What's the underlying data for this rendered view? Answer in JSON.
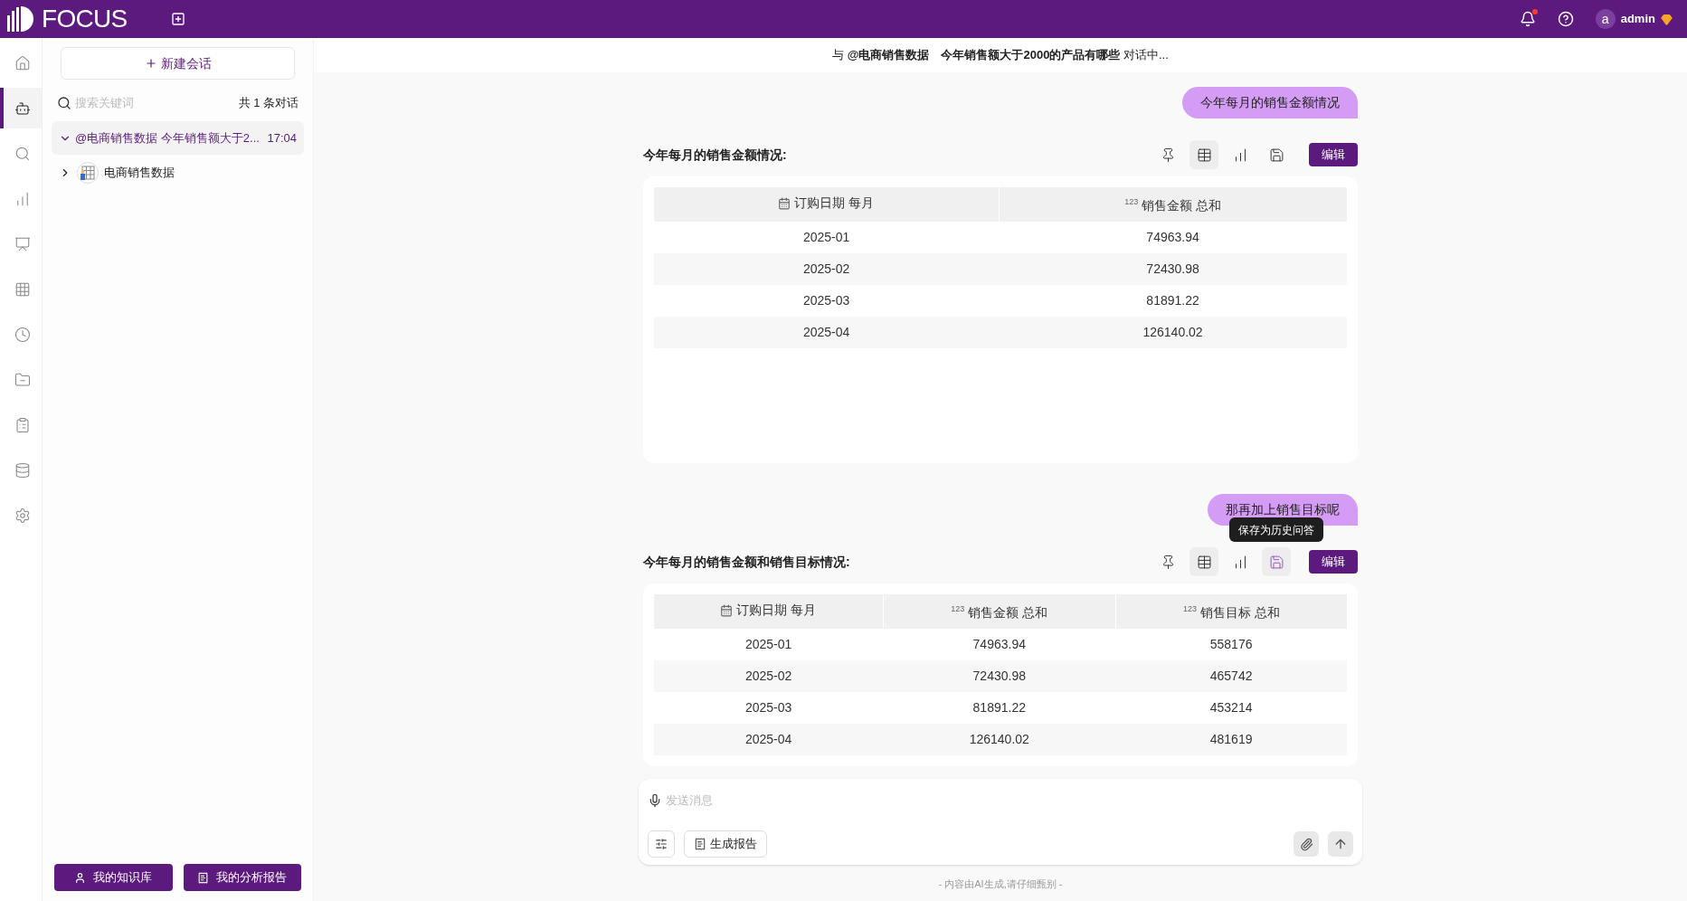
{
  "topbar": {
    "logo_text": "FOCUS",
    "user": {
      "avatar_letter": "a",
      "name": "admin"
    },
    "notification_dot": true
  },
  "nav_rail": [
    {
      "kind": "home",
      "selected": false
    },
    {
      "kind": "bot",
      "selected": true
    },
    {
      "kind": "search",
      "selected": false
    },
    {
      "kind": "chart",
      "selected": false
    },
    {
      "kind": "presentation",
      "selected": false
    },
    {
      "kind": "grid",
      "selected": false
    },
    {
      "kind": "clock",
      "selected": false
    },
    {
      "kind": "folder",
      "selected": false
    },
    {
      "kind": "clipboard",
      "selected": false
    },
    {
      "kind": "database",
      "selected": false
    },
    {
      "kind": "settings",
      "selected": false
    }
  ],
  "sessions": {
    "new_button": "新建会话",
    "search": {
      "placeholder": "搜索关键词"
    },
    "count": "共 1 条对话",
    "items": [
      {
        "title": "@电商销售数据 今年销售额大于2...",
        "time": "17:04",
        "selected": true,
        "expanded": true,
        "children": [
          {
            "title": "电商销售数据",
            "expanded": false
          }
        ]
      }
    ],
    "footer_buttons": [
      {
        "kind": "knowledge",
        "label": "我的知识库"
      },
      {
        "kind": "report",
        "label": "我的分析报告"
      }
    ]
  },
  "chat": {
    "header": "与 **@电商销售数据　今年销售额大于2000的产品有哪些** 对话中...",
    "turns": [
      {
        "question": "今年每月的销售金额情况",
        "answer_title": "今年每月的销售金额情况:",
        "edit_button": "编辑",
        "tools": [
          {
            "kind": "pin",
            "selected": false
          },
          {
            "kind": "table",
            "selected": true
          },
          {
            "kind": "chart",
            "selected": false
          },
          {
            "kind": "save",
            "selected": false
          }
        ],
        "table": {
          "columns": [
            {
              "kind": "date",
              "label": "订购日期 每月"
            },
            {
              "kind": "number",
              "type_mark": "123",
              "label": "销售金额 总和"
            }
          ],
          "rows": [
            [
              "2025-01",
              "74963.94"
            ],
            [
              "2025-02",
              "72430.98"
            ],
            [
              "2025-03",
              "81891.22"
            ],
            [
              "2025-04",
              "126140.02"
            ]
          ]
        }
      },
      {
        "question": "那再加上销售目标呢",
        "answer_title": "今年每月的销售金额和销售目标情况:",
        "edit_button": "编辑",
        "tooltip": "保存为历史问答",
        "tools": [
          {
            "kind": "pin",
            "selected": false
          },
          {
            "kind": "table",
            "selected": true
          },
          {
            "kind": "chart",
            "selected": false
          },
          {
            "kind": "save",
            "selected": true
          }
        ],
        "table": {
          "columns": [
            {
              "kind": "date",
              "label": "订购日期 每月"
            },
            {
              "kind": "number",
              "type_mark": "123",
              "label": "销售金额 总和"
            },
            {
              "kind": "number",
              "type_mark": "123",
              "label": "销售目标 总和"
            }
          ],
          "rows": [
            [
              "2025-01",
              "74963.94",
              "558176"
            ],
            [
              "2025-02",
              "72430.98",
              "465742"
            ],
            [
              "2025-03",
              "81891.22",
              "453214"
            ],
            [
              "2025-04",
              "126140.02",
              "481619"
            ]
          ]
        }
      }
    ],
    "input": {
      "placeholder": "发送消息",
      "report_button": "生成报告"
    },
    "disclaimer": "- 内容由AI生成,请仔细甄别 -"
  }
}
